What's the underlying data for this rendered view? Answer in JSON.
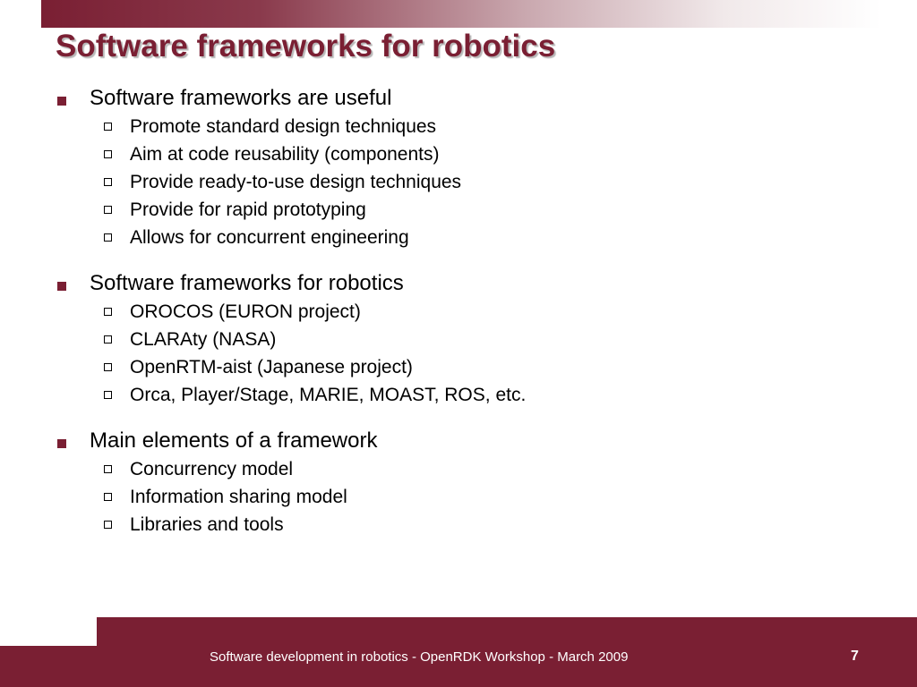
{
  "slide": {
    "title": "Software frameworks for robotics",
    "sections": [
      {
        "heading": "Software frameworks are useful",
        "items": [
          "Promote standard design techniques",
          "Aim at code reusability (components)",
          "Provide ready-to-use design techniques",
          "Provide for rapid prototyping",
          "Allows for concurrent engineering"
        ]
      },
      {
        "heading": "Software frameworks for robotics",
        "items": [
          "OROCOS (EURON project)",
          "CLARAty (NASA)",
          "OpenRTM-aist (Japanese project)",
          "Orca, Player/Stage, MARIE, MOAST, ROS, etc."
        ]
      },
      {
        "heading": "Main elements of a framework",
        "items": [
          "Concurrency model",
          "Information sharing model",
          "Libraries and tools"
        ]
      }
    ]
  },
  "footer": {
    "text": "Software development in robotics - OpenRDK Workshop - March 2009",
    "page_number": "7"
  },
  "colors": {
    "accent": "#7a1f33",
    "text": "#000000",
    "footer_text": "#ffffff"
  },
  "icons": {
    "main_bullet": "filled-square-bullet-icon",
    "sub_bullet": "hollow-square-bullet-icon"
  }
}
